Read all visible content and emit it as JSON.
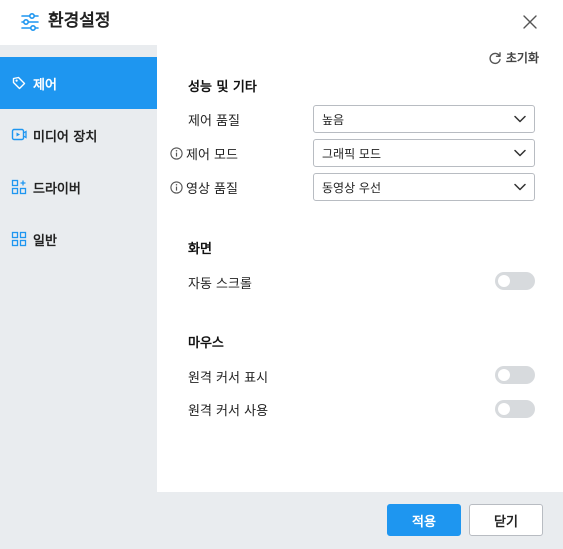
{
  "window": {
    "title": "환경설정",
    "icon": "sliders-icon",
    "close_icon": "close-icon"
  },
  "sidebar": {
    "items": [
      {
        "label": "제어",
        "icon": "tag-icon",
        "active": true
      },
      {
        "label": "미디어 장치",
        "icon": "media-device-icon",
        "active": false
      },
      {
        "label": "드라이버",
        "icon": "driver-grid-icon",
        "active": false
      },
      {
        "label": "일반",
        "icon": "general-grid-icon",
        "active": false
      }
    ]
  },
  "main": {
    "reset_label": "초기화",
    "reset_icon": "refresh-icon",
    "sections": [
      {
        "title": "성능 및 기타",
        "rows": [
          {
            "label": "제어 품질",
            "value": "높음",
            "info": false
          },
          {
            "label": "제어 모드",
            "value": "그래픽 모드",
            "info": true
          },
          {
            "label": "영상 품질",
            "value": "동영상 우선",
            "info": true
          }
        ]
      },
      {
        "title": "화면",
        "rows": [
          {
            "label": "자동 스크롤",
            "enabled": false
          }
        ]
      },
      {
        "title": "마우스",
        "rows": [
          {
            "label": "원격 커서 표시",
            "enabled": false
          },
          {
            "label": "원격 커서 사용",
            "enabled": false
          }
        ]
      }
    ]
  },
  "footer": {
    "apply_label": "적용",
    "close_label": "닫기"
  },
  "colors": {
    "accent": "#1e96f0",
    "sidebar_bg": "#e9ecef",
    "toggle_off": "#d7dadd"
  }
}
